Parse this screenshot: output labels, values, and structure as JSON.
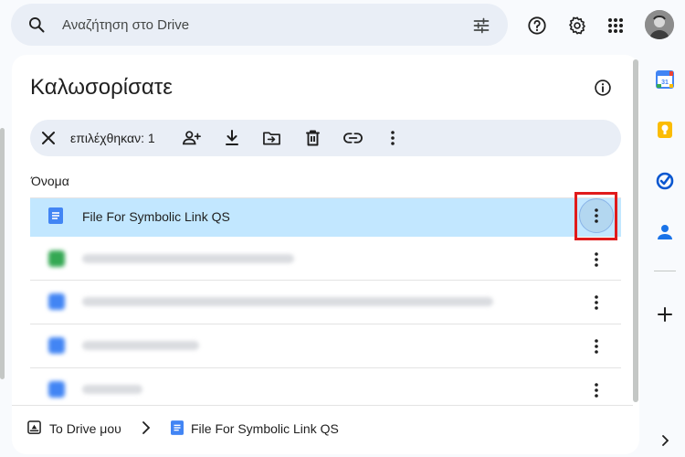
{
  "search": {
    "placeholder": "Αναζήτηση στο Drive"
  },
  "page": {
    "title": "Καλωσορίσατε"
  },
  "selection_bar": {
    "count_label": "επιλέχθηκαν: 1"
  },
  "file_list": {
    "column_header": "Όνομα",
    "rows": [
      {
        "name": "File For Symbolic Link QS",
        "icon": "google-docs-icon",
        "selected": true
      }
    ]
  },
  "footer": {
    "root_label": "Το Drive μου",
    "current_label": "File For Symbolic Link QS"
  },
  "colors": {
    "accent": "#0b57d0",
    "selected_row": "#c2e7ff",
    "highlight_box": "#e01b1b"
  }
}
